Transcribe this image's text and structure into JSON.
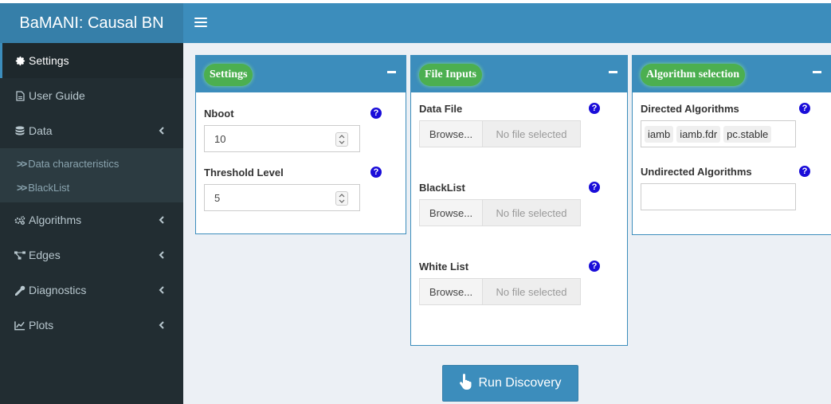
{
  "app": {
    "title": "BaMANI: Causal BN"
  },
  "sidebar": {
    "items": [
      {
        "label": "Settings",
        "icon": "gear-icon"
      },
      {
        "label": "User Guide",
        "icon": "file-pdf-icon"
      },
      {
        "label": "Data",
        "icon": "database-icon"
      },
      {
        "label": "Algorithms",
        "icon": "gears-icon"
      },
      {
        "label": "Edges",
        "icon": "network-icon"
      },
      {
        "label": "Diagnostics",
        "icon": "wrench-icon"
      },
      {
        "label": "Plots",
        "icon": "line-chart-icon"
      }
    ],
    "data_submenu": [
      {
        "label": "Data characteristics"
      },
      {
        "label": "BlackList"
      }
    ]
  },
  "settings_box": {
    "title": "Settings",
    "nboot": {
      "label": "Nboot",
      "value": "10"
    },
    "threshold": {
      "label": "Threshold Level",
      "value": "5"
    }
  },
  "file_box": {
    "title": "File Inputs",
    "browse_label": "Browse...",
    "no_file_label": "No file selected",
    "fields": [
      {
        "label": "Data File"
      },
      {
        "label": "BlackList"
      },
      {
        "label": "White List"
      }
    ]
  },
  "algo_box": {
    "title": "Algorithm selection",
    "directed": {
      "label": "Directed Algorithms",
      "selected": [
        "iamb",
        "iamb.fdr",
        "pc.stable"
      ]
    },
    "undirected": {
      "label": "Undirected Algorithms"
    }
  },
  "run_button": {
    "label": "Run Discovery"
  },
  "colors": {
    "header": "#3c8dbc",
    "logo": "#367fa9",
    "sidebar": "#222d32",
    "pill": "#4caf50",
    "help": "#1a0dd9"
  }
}
